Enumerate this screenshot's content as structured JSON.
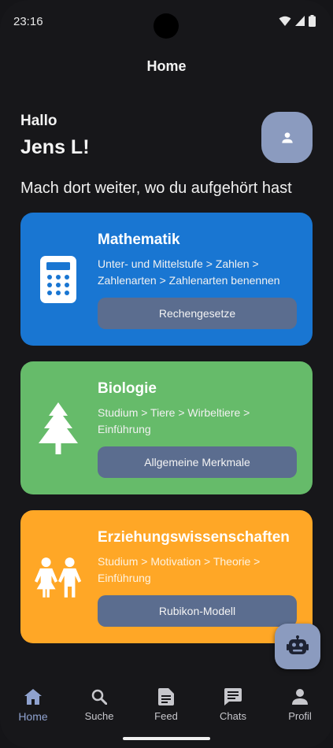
{
  "status_bar": {
    "time": "23:16",
    "icons": [
      "wifi-icon",
      "signal-icon",
      "battery-icon"
    ]
  },
  "app_bar": {
    "title": "Home"
  },
  "greeting": {
    "hello": "Hallo",
    "name": "Jens L!"
  },
  "resume_heading": "Mach dort weiter, wo du aufgehört hast",
  "cards": [
    {
      "title": "Mathematik",
      "path": "Unter- und Mittelstufe > Zahlen > Zahlenarten > Zahlenarten benennen",
      "button": "Rechengesetze",
      "icon": "calculator-icon",
      "color": "#1976d2"
    },
    {
      "title": "Biologie",
      "path": "Studium > Tiere > Wirbeltiere > Einführung",
      "button": "Allgemeine Merkmale",
      "icon": "tree-icon",
      "color": "#66bb6a"
    },
    {
      "title": "Erziehungswissenschaften",
      "path": "Studium > Motivation > Theorie > Einführung",
      "button": "Rubikon-Modell",
      "icon": "children-icon",
      "color": "#ffa726"
    }
  ],
  "bottom_nav": [
    {
      "label": "Home",
      "icon": "home-icon",
      "active": true
    },
    {
      "label": "Suche",
      "icon": "search-icon",
      "active": false
    },
    {
      "label": "Feed",
      "icon": "feed-icon",
      "active": false
    },
    {
      "label": "Chats",
      "icon": "chat-icon",
      "active": false
    },
    {
      "label": "Profil",
      "icon": "person-icon",
      "active": false
    }
  ],
  "colors": {
    "background": "#17171a",
    "accent": "#8fa2cf",
    "button": "#5b6d8f",
    "avatar": "#8b9bbf"
  }
}
